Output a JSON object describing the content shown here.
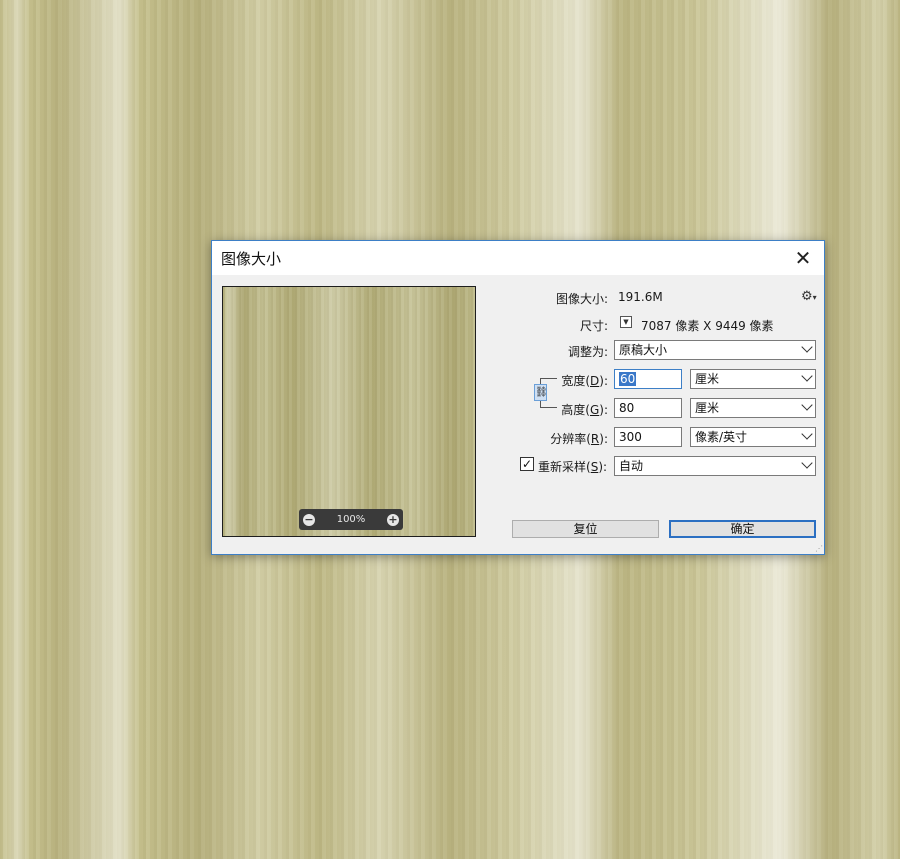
{
  "dialog": {
    "title": "图像大小",
    "close_glyph": "✕"
  },
  "preview": {
    "zoom_value": "100%",
    "zoom_out_glyph": "−",
    "zoom_in_glyph": "+"
  },
  "info": {
    "image_size_label": "图像大小:",
    "image_size_value": "191.6M",
    "dimensions_label": "尺寸:",
    "dimensions_value": "7087 像素  X  9449 像素"
  },
  "fit_to": {
    "label": "调整为:",
    "value": "原稿大小"
  },
  "width": {
    "label": "宽度(D):",
    "value": "60",
    "unit": "厘米"
  },
  "height": {
    "label": "高度(G):",
    "value": "80",
    "unit": "厘米"
  },
  "resolution": {
    "label": "分辨率(R):",
    "value": "300",
    "unit": "像素/英寸"
  },
  "resample": {
    "label": "重新采样(S):",
    "checked": true,
    "check_glyph": "✓",
    "value": "自动"
  },
  "buttons": {
    "reset": "复位",
    "ok": "确定"
  },
  "icons": {
    "gear": "gear-icon",
    "link": "link-icon",
    "close": "close-icon"
  },
  "colors": {
    "accent": "#3d7fc6",
    "selection": "#3a78c8"
  }
}
